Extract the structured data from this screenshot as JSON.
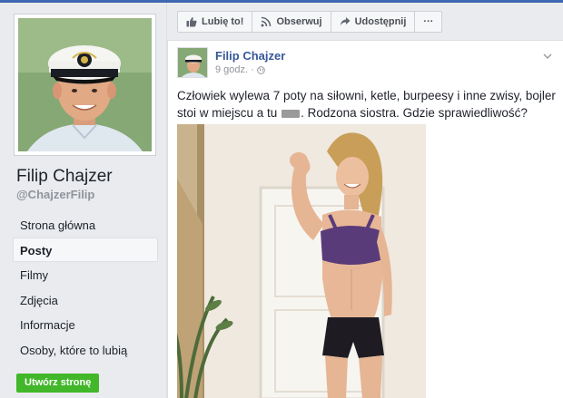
{
  "page": {
    "name": "Filip Chajzer",
    "handle": "@ChajzerFilip"
  },
  "nav": {
    "items": [
      {
        "label": "Strona główna",
        "active": false
      },
      {
        "label": "Posty",
        "active": true
      },
      {
        "label": "Filmy",
        "active": false
      },
      {
        "label": "Zdjęcia",
        "active": false
      },
      {
        "label": "Informacje",
        "active": false
      },
      {
        "label": "Osoby, które to lubią",
        "active": false
      }
    ],
    "create_page_label": "Utwórz stronę"
  },
  "toolbar": {
    "like_label": "Lubię to!",
    "follow_label": "Obserwuj",
    "share_label": "Udostępnij",
    "more_label": "···"
  },
  "post": {
    "author": "Filip Chajzer",
    "time": "9 godz.",
    "text_before": "Człowiek wylewa 7 poty na siłowni, ketle, burpeesy i inne zwisy, bojler stoi w miejscu a tu",
    "text_after": ". Rodzona siostra. Gdzie sprawiedliwość?"
  },
  "colors": {
    "link_blue": "#365899",
    "brand_blue": "#4267b2",
    "green_button": "#42b72a",
    "background": "#e9ebee"
  }
}
